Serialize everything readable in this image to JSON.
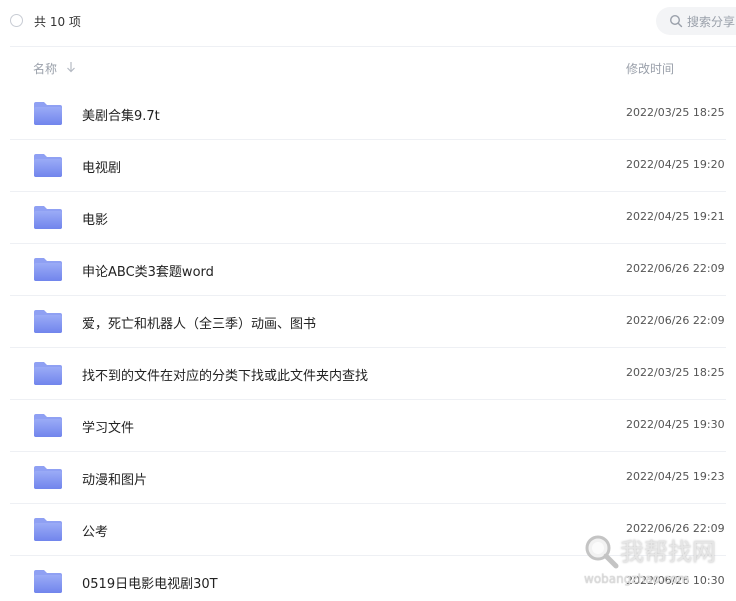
{
  "header": {
    "count_text": "共 10 项",
    "search_placeholder": "搜索分享"
  },
  "columns": {
    "name": "名称",
    "modified": "修改时间"
  },
  "files": [
    {
      "name": "美剧合集9.7t",
      "modified": "2022/03/25 18:25"
    },
    {
      "name": "电视剧",
      "modified": "2022/04/25 19:20"
    },
    {
      "name": "电影",
      "modified": "2022/04/25 19:21"
    },
    {
      "name": "申论ABC类3套题word",
      "modified": "2022/06/26 22:09"
    },
    {
      "name": "爱，死亡和机器人（全三季）动画、图书",
      "modified": "2022/06/26 22:09"
    },
    {
      "name": "找不到的文件在对应的分类下找或此文件夹内查找",
      "modified": "2022/03/25 18:25"
    },
    {
      "name": "学习文件",
      "modified": "2022/04/25 19:30"
    },
    {
      "name": "动漫和图片",
      "modified": "2022/04/25 19:23"
    },
    {
      "name": "公考",
      "modified": "2022/06/26 22:09"
    },
    {
      "name": "0519日电影电视剧30T",
      "modified": "2022/06/26 10:30"
    }
  ],
  "watermark": {
    "title": "我帮找网",
    "domain": "wobangzhao.com"
  },
  "colors": {
    "folder": "#7b8ff0",
    "text": "#222222",
    "muted": "#9aa0aa",
    "divider": "#eef0f4"
  }
}
